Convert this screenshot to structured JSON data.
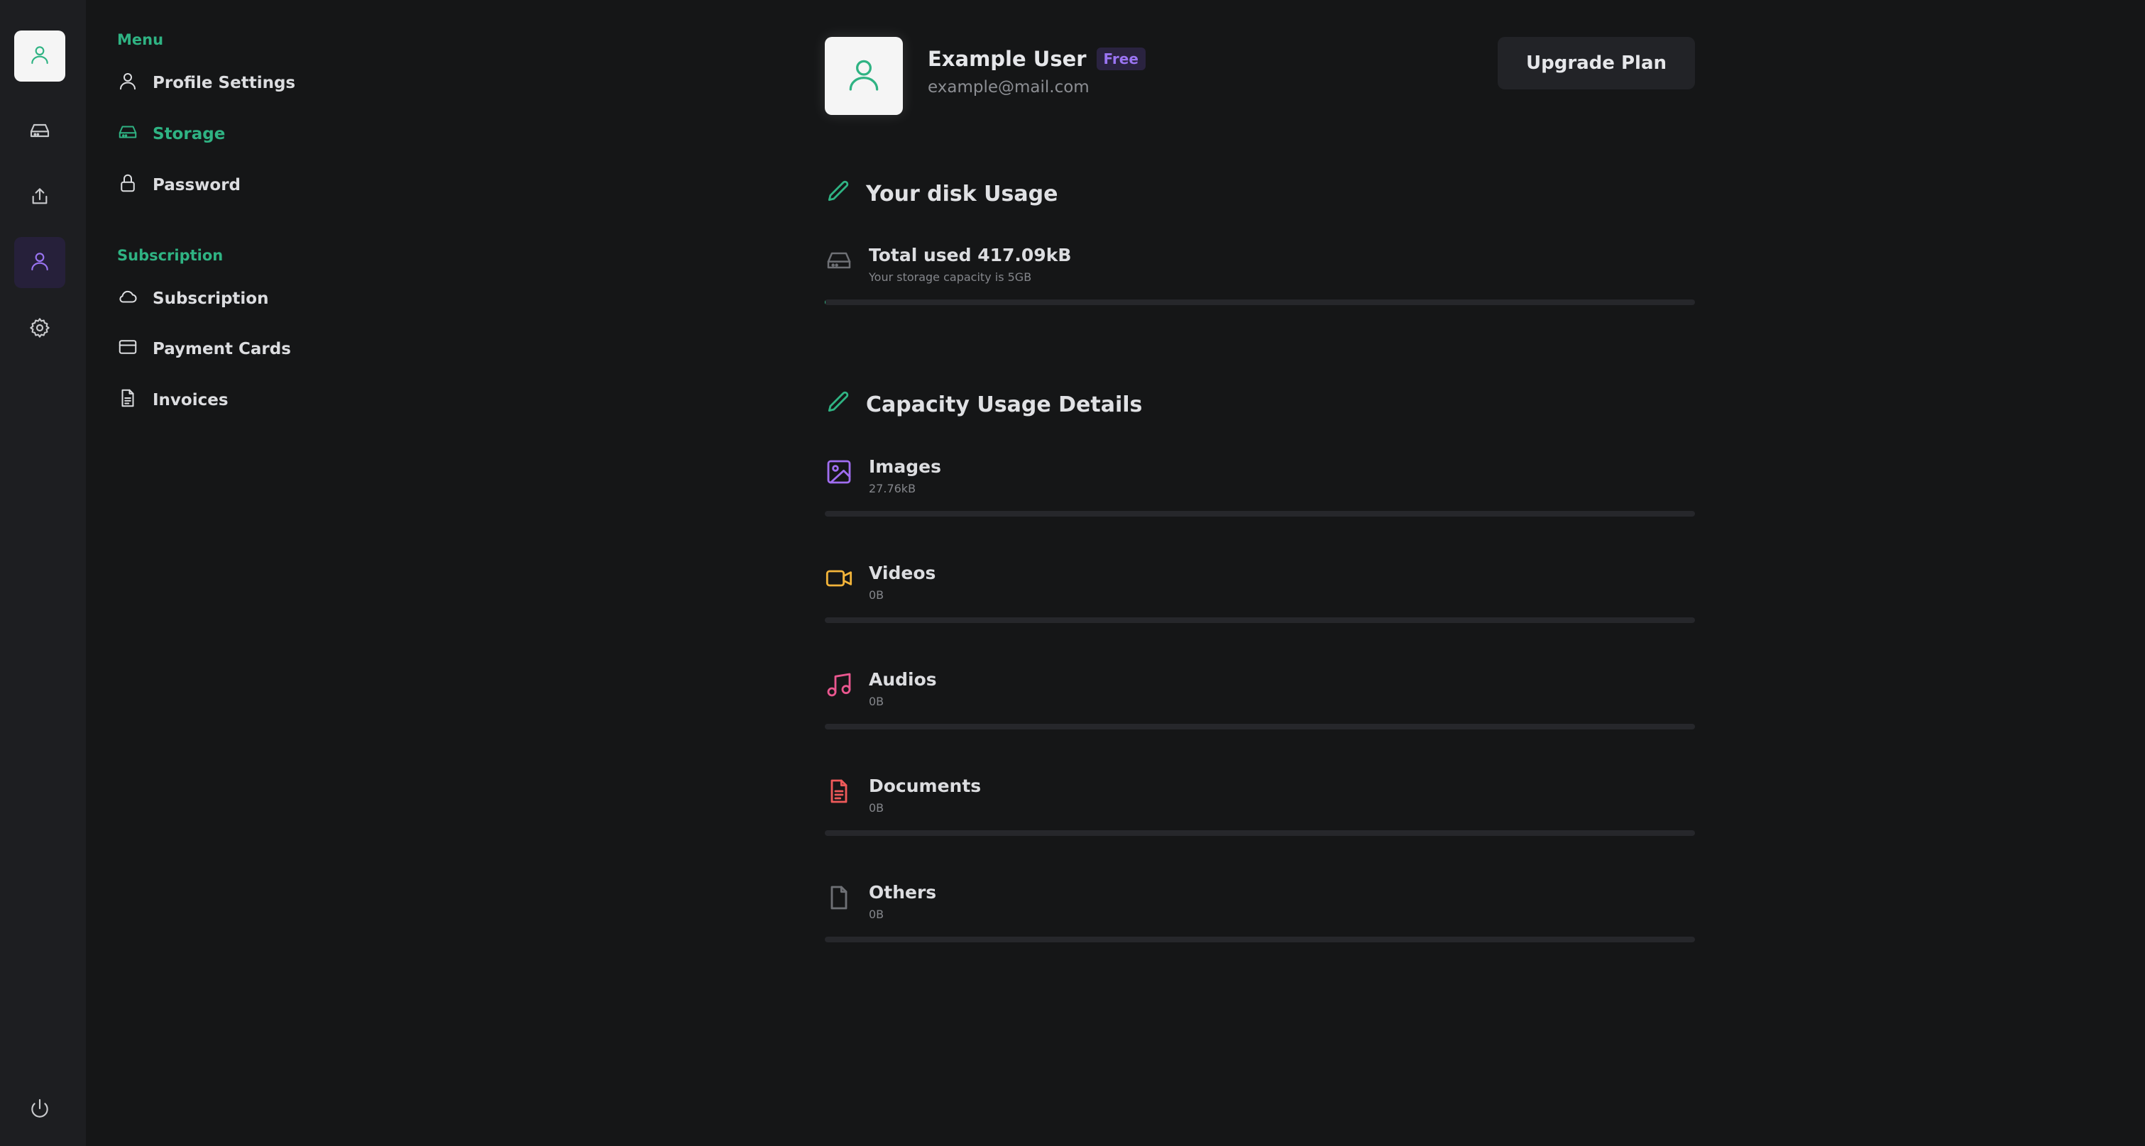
{
  "rail": {
    "items": [
      {
        "name": "profile",
        "icon": "user-icon"
      },
      {
        "name": "storage",
        "icon": "hard-drive-icon"
      },
      {
        "name": "upload",
        "icon": "upload-icon"
      },
      {
        "name": "account",
        "icon": "user-icon",
        "active": true
      },
      {
        "name": "settings",
        "icon": "gear-icon"
      }
    ],
    "bottom_icon": "power-icon"
  },
  "sidebar": {
    "menu_label": "Menu",
    "menu_items": [
      {
        "label": "Profile Settings",
        "icon": "user-icon"
      },
      {
        "label": "Storage",
        "icon": "hard-drive-icon",
        "active": true
      },
      {
        "label": "Password",
        "icon": "lock-icon"
      }
    ],
    "subscription_label": "Subscription",
    "subscription_items": [
      {
        "label": "Subscription",
        "icon": "cloud-icon"
      },
      {
        "label": "Payment Cards",
        "icon": "credit-card-icon"
      },
      {
        "label": "Invoices",
        "icon": "document-icon"
      }
    ]
  },
  "user": {
    "name": "Example User",
    "plan_badge": "Free",
    "email": "example@mail.com",
    "upgrade_label": "Upgrade Plan"
  },
  "disk_usage": {
    "title": "Your disk Usage",
    "total_label": "Total used 417.09kB",
    "capacity_note": "Your storage capacity is 5GB",
    "fraction_used": 0.0001
  },
  "capacity_details": {
    "title": "Capacity Usage Details",
    "items": [
      {
        "label": "Images",
        "size": "27.76kB",
        "icon": "image-icon",
        "color": "#a06df0",
        "fraction": 0.0
      },
      {
        "label": "Videos",
        "size": "0B",
        "icon": "video-icon",
        "color": "#f2b43a",
        "fraction": 0.0
      },
      {
        "label": "Audios",
        "size": "0B",
        "icon": "music-icon",
        "color": "#e9578f",
        "fraction": 0.0
      },
      {
        "label": "Documents",
        "size": "0B",
        "icon": "document-icon",
        "color": "#ee5a5a",
        "fraction": 0.0
      },
      {
        "label": "Others",
        "size": "0B",
        "icon": "file-icon",
        "color": "#6e7075",
        "fraction": 0.0
      }
    ]
  },
  "colors": {
    "accent": "#2fb383",
    "purple": "#9a74f2",
    "background": "#151617",
    "rail": "#1d1e21"
  }
}
